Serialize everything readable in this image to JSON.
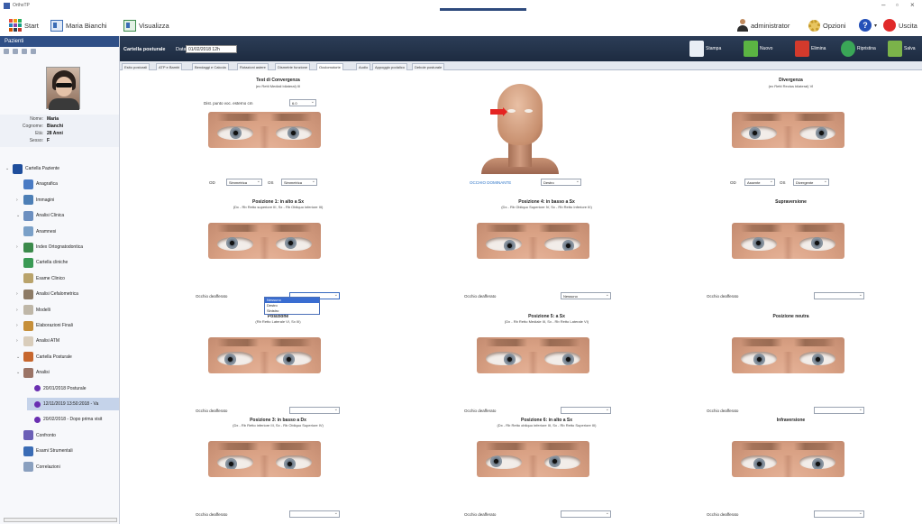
{
  "window": {
    "title": "OrthoTP"
  },
  "menubar": {
    "start": "Start",
    "patient": "Maria Bianchi",
    "view": "Visualizza",
    "user": "administrator",
    "options": "Opzioni",
    "exit": "Uscita"
  },
  "sidebar": {
    "header": "Pazienti",
    "patient": [
      {
        "k": "Nome:",
        "v": "Maria"
      },
      {
        "k": "Cognome:",
        "v": "Bianchi"
      },
      {
        "k": "Età:",
        "v": "28 Anni"
      },
      {
        "k": "Sesso:",
        "v": "F"
      }
    ],
    "tree": [
      {
        "label": "Cartella Paziente",
        "level": 0,
        "arrow": "⌄",
        "icon": "folder-icon",
        "color": "#1f4e9c"
      },
      {
        "label": "Anagrafica",
        "level": 1,
        "arrow": "",
        "icon": "person-icon",
        "color": "#4a7bc4"
      },
      {
        "label": "Immagini",
        "level": 1,
        "arrow": "›",
        "icon": "image-icon",
        "color": "#4d7fb6"
      },
      {
        "label": "Analisi Clinica",
        "level": 1,
        "arrow": "⌄",
        "icon": "stethoscope-icon",
        "color": "#6c8fc0"
      },
      {
        "label": "Anamnesi",
        "level": 1,
        "arrow": "",
        "icon": "clipboard-icon",
        "color": "#7aa0c8"
      },
      {
        "label": "Index Ortognatodontica",
        "level": 1,
        "arrow": "›",
        "icon": "group-icon",
        "color": "#3b8a4b"
      },
      {
        "label": "Cartella cliniche",
        "level": 1,
        "arrow": "",
        "icon": "car-icon",
        "color": "#3a9a55"
      },
      {
        "label": "Esame Clinico",
        "level": 1,
        "arrow": "",
        "icon": "document-icon",
        "color": "#b9a36b"
      },
      {
        "label": "Analisi Cefalometrica",
        "level": 1,
        "arrow": "›",
        "icon": "skull-icon",
        "color": "#8d7b66"
      },
      {
        "label": "Modelli",
        "level": 1,
        "arrow": "›",
        "icon": "model-icon",
        "color": "#bfb7a8"
      },
      {
        "label": "Elaborazioni Finali",
        "level": 1,
        "arrow": "›",
        "icon": "chart-icon",
        "color": "#c68f3a"
      },
      {
        "label": "Analisi ATM",
        "level": 1,
        "arrow": "›",
        "icon": "jaw-icon",
        "color": "#d9cdbb"
      },
      {
        "label": "Cartella Posturale",
        "level": 1,
        "arrow": "⌄",
        "icon": "posture-icon",
        "color": "#c7672e"
      },
      {
        "label": "Analisi",
        "level": 1,
        "arrow": "⌄",
        "icon": "body-icon",
        "color": "#9b7466"
      },
      {
        "label": "20/01/2018 Posturale",
        "level": 2,
        "arrow": "",
        "icon": "dot-icon",
        "color": "#6a2fb1"
      },
      {
        "label": "12/11/2019 13:50:2018 - Va",
        "level": 2,
        "arrow": "",
        "icon": "dot-icon",
        "color": "#6a2fb1",
        "selected": true
      },
      {
        "label": "20/02/2018 - Dopo prima visit",
        "level": 2,
        "arrow": "",
        "icon": "dot-icon",
        "color": "#6a2fb1"
      },
      {
        "label": "Confronto",
        "level": 1,
        "arrow": "",
        "icon": "compare-icon",
        "color": "#6b5fb6"
      },
      {
        "label": "Esami Strumentali",
        "level": 1,
        "arrow": "",
        "icon": "monitor-icon",
        "color": "#3a6cb5"
      },
      {
        "label": "Correlazioni",
        "level": 1,
        "arrow": "",
        "icon": "network-icon",
        "color": "#8aa0bf"
      }
    ]
  },
  "toolbar": {
    "section": "Cartella posturale",
    "date_label": "Data",
    "date_value": "01/02/2018 12h",
    "buttons": [
      {
        "label": "Stampa",
        "icon": "printer-icon",
        "color": "#e9eef5"
      },
      {
        "label": "Nuovo",
        "icon": "new-doc-icon",
        "color": "#5bb443"
      },
      {
        "label": "Elimina",
        "icon": "delete-doc-icon",
        "color": "#d33a2c"
      },
      {
        "label": "Ripristina",
        "icon": "restore-icon",
        "color": "#3aa657"
      },
      {
        "label": "Salva",
        "icon": "save-icon",
        "color": "#7bb34a"
      }
    ]
  },
  "tabs": [
    "Esito posturali",
    "ATP e Bambi",
    "Bendaggi e Calcola",
    "Rotazioni astere",
    "Dismetrie funzione",
    "Oculomotorie",
    "Audio",
    "Appoggio podalico",
    "Debole posturale"
  ],
  "active_tab_index": 5,
  "oculo": {
    "convergence": {
      "title": "Test di Convergenza",
      "subtitle": "(ex Retti Mediali bilateral) III",
      "dist_label": "Dist. punto voc. esterno cm",
      "dist_value": "6.0",
      "od_label": "OD",
      "od_value": "Simmetrica",
      "os_label": "OS",
      "os_value": "Simmetrica"
    },
    "center": {
      "link": "OCCHIO DOMINANTE",
      "value": "Destro"
    },
    "divergence": {
      "title": "Divergenza",
      "subtitle": "(ex Retti Rectus bilateral) VI",
      "od_label": "OD",
      "od_value": "Assente",
      "os_label": "OS",
      "os_value": "Divergente"
    },
    "deficit_label": "Occhio deafferato",
    "positions": [
      {
        "title": "Posizione 1: in alto a Sx",
        "subtitle": "(Dx - Rb Retto superiore III, Sx - Rb Obliquo inferiore III)",
        "value": ""
      },
      {
        "title": "Posizione 4: in basso a Sx",
        "subtitle": "(Dx - Rb Obliquo Superiore IV, Sx - Rb Retto Inferiore III)",
        "value": "Nessuno"
      },
      {
        "title": "Supraversione",
        "subtitle": "",
        "value": ""
      },
      {
        "title": "Posizione",
        "subtitle": "(Rb Retto Laterale VI, Sx III)",
        "value": ""
      },
      {
        "title": "Posizione 5: a Sx",
        "subtitle": "(Dx - Rb Retto Mediale III, Sx - Rb Retto Laterale VI)",
        "value": ""
      },
      {
        "title": "Posizione neutra",
        "subtitle": "",
        "value": ""
      },
      {
        "title": "Posizione 3: in basso a Dx",
        "subtitle": "(Dx - Rb Retto inferiore III, Sx - Rb Obliquo Superiore IV)",
        "value": ""
      },
      {
        "title": "Posizione 6: in alto a Sx",
        "subtitle": "(Dx - Rb Retto obliquo inferiore III, Sx - Rb Retto Superiore III)",
        "value": ""
      },
      {
        "title": "Infraversione",
        "subtitle": "",
        "value": ""
      }
    ],
    "dropdown_options": [
      "Nessuno",
      "Destro",
      "Sinistro"
    ]
  }
}
